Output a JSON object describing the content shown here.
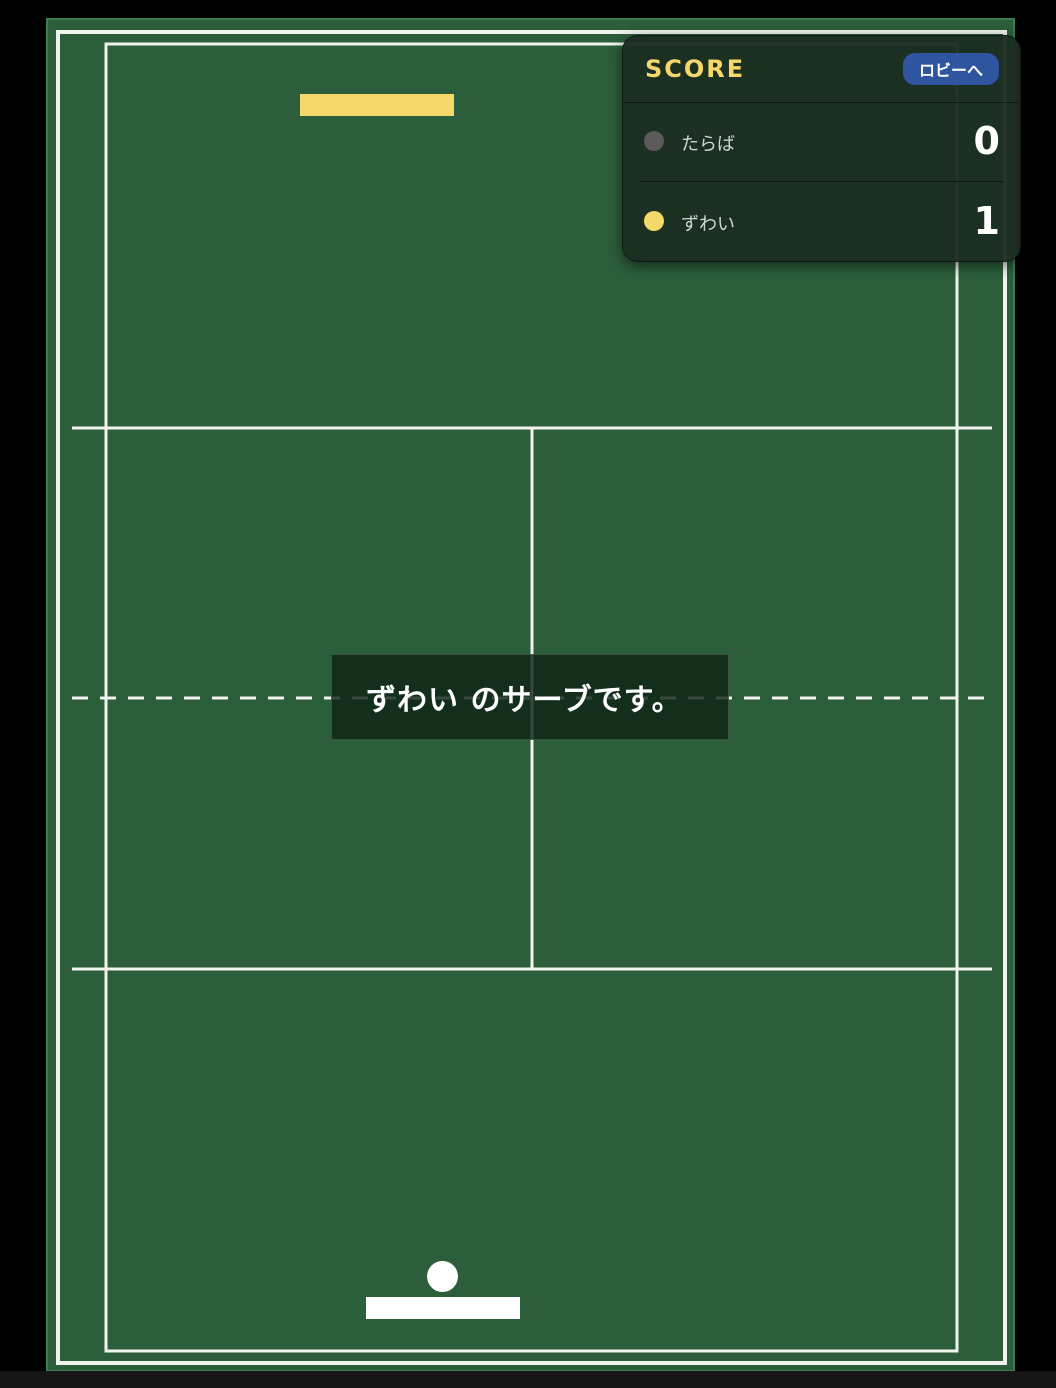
{
  "colors": {
    "court": "#2c5e3b",
    "lines": "#f0f3ef",
    "paddle_top": "#f5d86a",
    "paddle_bottom": "#ffffff",
    "ball": "#ffffff",
    "lobby_button": "#2f55a0",
    "score_title": "#f5d86a"
  },
  "scoreboard": {
    "title": "SCORE",
    "lobby_button_label": "ロビーへ",
    "players": [
      {
        "name": "たらば",
        "score": "0",
        "dot_color": "#5a5a5a"
      },
      {
        "name": "ずわい",
        "score": "1",
        "dot_color": "#f5d86a"
      }
    ]
  },
  "banner": {
    "message": "ずわい のサーブです。"
  }
}
